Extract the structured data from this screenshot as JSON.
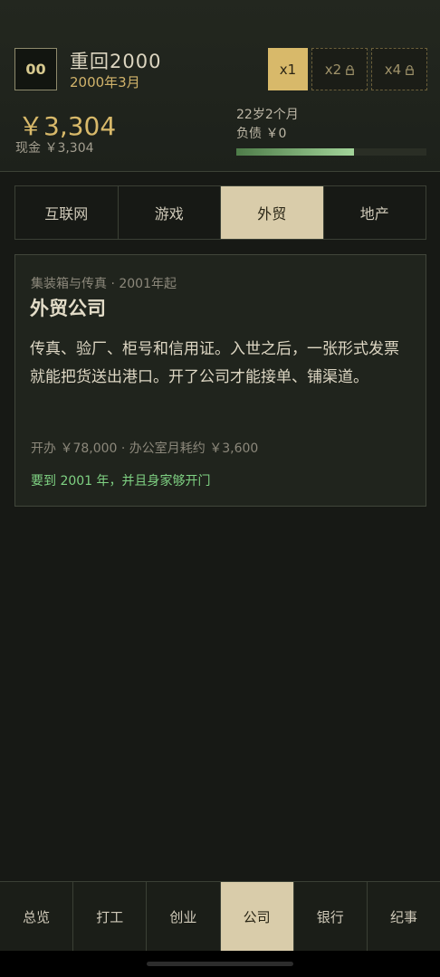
{
  "header": {
    "logo": "00",
    "title": "重回2000",
    "date": "2000年3月",
    "speeds": [
      {
        "label": "x1",
        "active": true,
        "locked": false
      },
      {
        "label": "x2",
        "active": false,
        "locked": true
      },
      {
        "label": "x4",
        "active": false,
        "locked": true
      }
    ],
    "money": "￥3,304",
    "cash": "现金 ￥3,304",
    "age": "22岁2个月",
    "debt": "负债 ￥0",
    "progress": 0.62
  },
  "tabs": [
    "互联网",
    "游戏",
    "外贸",
    "地产"
  ],
  "active_tab": 2,
  "card": {
    "subtitle": "集装箱与传真 · 2001年起",
    "title": "外贸公司",
    "description": "传真、验厂、柜号和信用证。入世之后，一张形式发票就能把货送出港口。开了公司才能接单、铺渠道。",
    "cost": "开办 ￥78,000 · 办公室月耗约 ￥3,600",
    "requirement": "要到 2001 年，并且身家够开门"
  },
  "bottom_nav": [
    "总览",
    "打工",
    "创业",
    "公司",
    "银行",
    "纪事"
  ],
  "active_nav": 3,
  "colors": {
    "accent": "#d8b96a",
    "active_tab_bg": "#d9ccaa",
    "requirement_green": "#7fd283"
  },
  "icons": {
    "lock": "lock-icon"
  }
}
